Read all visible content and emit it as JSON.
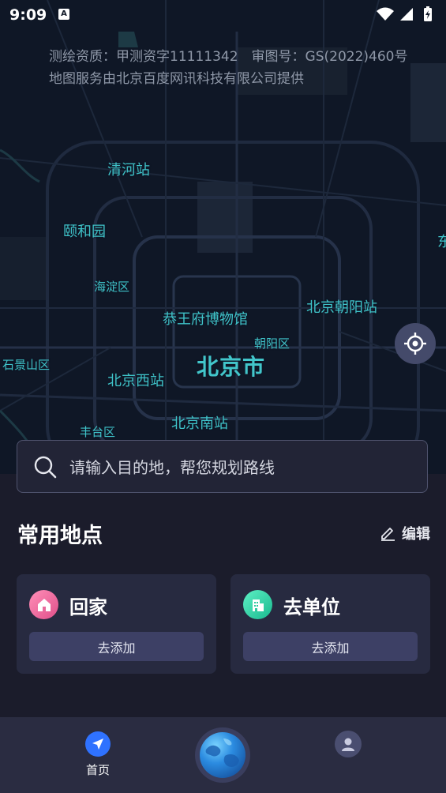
{
  "status_bar": {
    "time": "9:09",
    "app_indicator": "A"
  },
  "map": {
    "credit_line_1": "测绘资质：甲测资字11111342　审图号：GS(2022)460号",
    "credit_line_2": "地图服务由北京百度网讯科技有限公司提供",
    "labels": {
      "qinghe": "清河站",
      "yiheyuan": "颐和园",
      "haidian": "海淀区",
      "gongwangfu": "恭王府博物馆",
      "chaoyang_station": "北京朝阳站",
      "chaoyang_district": "朝阳区",
      "shijingshan": "石景山区",
      "city": "北京市",
      "west_station": "北京西站",
      "south_station": "北京南站",
      "fengtai": "丰台区",
      "edge": "东"
    }
  },
  "search": {
    "placeholder": "请输入目的地，帮您规划路线"
  },
  "common_places": {
    "title": "常用地点",
    "edit_label": "编辑",
    "home": {
      "title": "回家",
      "button": "去添加",
      "color": "#f06aa0"
    },
    "work": {
      "title": "去单位",
      "button": "去添加",
      "color": "#2fd3a6"
    }
  },
  "tabbar": {
    "home_label": "首页",
    "accent": "#2f72ff"
  }
}
